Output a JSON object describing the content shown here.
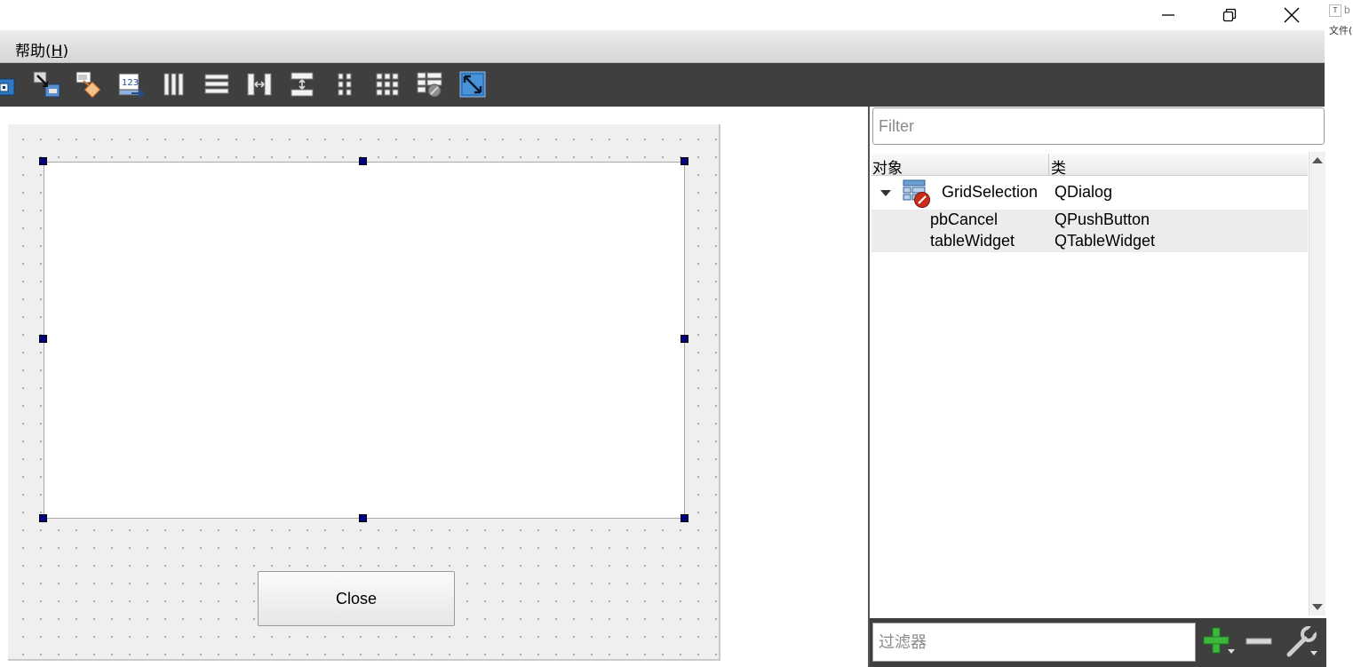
{
  "window": {
    "minimize_label": "Minimize",
    "maximize_label": "Restore",
    "close_label": "Close window"
  },
  "edge_strip": {
    "icon_letter": "T",
    "letter": "b",
    "text": "文件("
  },
  "menu": {
    "help": {
      "prefix": "帮助(",
      "accel": "H",
      "suffix": ")"
    }
  },
  "toolbar": {
    "icons": [
      "widget-editing-mode",
      "signal-slot-editing-mode",
      "buddy-editing-mode",
      "tab-order-editing-mode",
      "layout-horizontally",
      "layout-vertically",
      "layout-horizontal-splitter",
      "layout-vertical-splitter",
      "layout-form",
      "layout-grid",
      "break-layout",
      "adjust-size"
    ]
  },
  "form": {
    "close_button_label": "Close"
  },
  "inspector": {
    "filter_placeholder": "Filter",
    "columns": {
      "object": "对象",
      "class": "类"
    },
    "rows": [
      {
        "object": "GridSelection",
        "class": "QDialog"
      },
      {
        "object": "pbCancel",
        "class": "QPushButton"
      },
      {
        "object": "tableWidget",
        "class": "QTableWidget"
      }
    ],
    "signal_filter_placeholder": "过滤器"
  },
  "colors": {
    "toolbar_bg": "#3f3f3f",
    "handle": "#000080",
    "add_green": "#3cb83c"
  }
}
